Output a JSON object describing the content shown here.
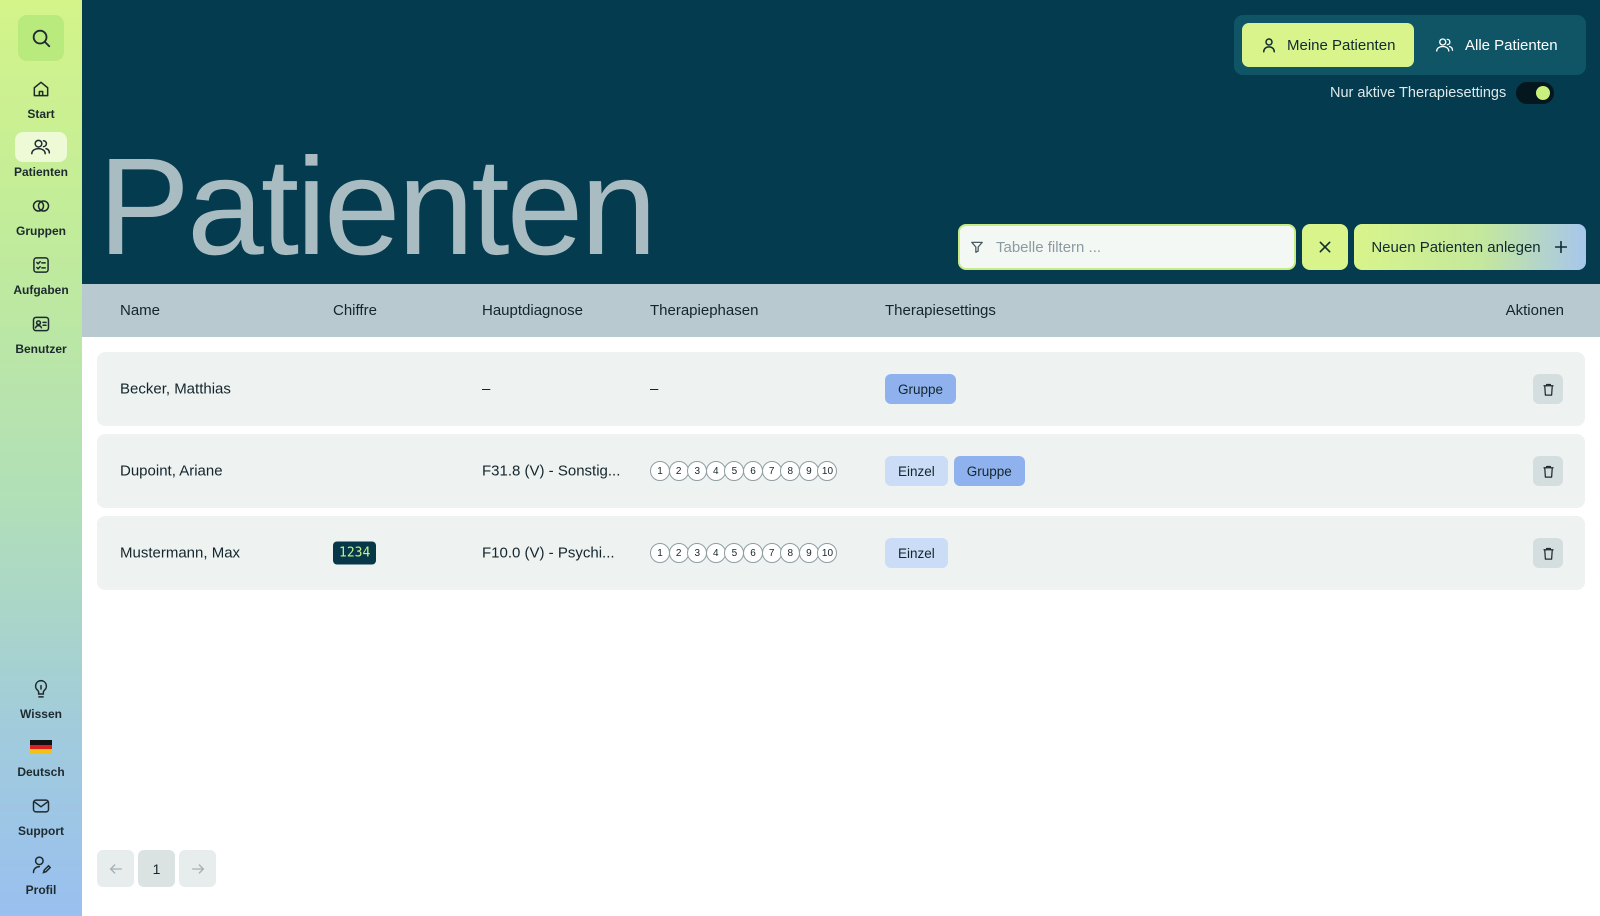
{
  "sidebar": {
    "top_items": [
      {
        "label": "Start",
        "icon": "home-icon"
      },
      {
        "label": "Patienten",
        "icon": "users-icon",
        "active": true
      },
      {
        "label": "Gruppen",
        "icon": "groups-icon"
      },
      {
        "label": "Aufgaben",
        "icon": "tasks-icon"
      },
      {
        "label": "Benutzer",
        "icon": "user-card-icon"
      }
    ],
    "bottom_items": [
      {
        "label": "Wissen",
        "icon": "lightbulb-icon"
      },
      {
        "label": "Deutsch",
        "icon": "german-flag-icon"
      },
      {
        "label": "Support",
        "icon": "mail-icon"
      },
      {
        "label": "Profil",
        "icon": "profile-icon"
      }
    ]
  },
  "header": {
    "title": "Patienten",
    "scope": {
      "mine": "Meine Patienten",
      "all": "Alle Patienten",
      "selected": "mine"
    },
    "active_toggle": {
      "label": "Nur aktive Therapiesettings",
      "on": true
    },
    "filter": {
      "placeholder": "Tabelle filtern ...",
      "value": ""
    },
    "add_button": "Neuen Patienten anlegen"
  },
  "table": {
    "columns": [
      "Name",
      "Chiffre",
      "Hauptdiagnose",
      "Therapiephasen",
      "Therapiesettings",
      "Aktionen"
    ],
    "rows": [
      {
        "name": "Becker, Matthias",
        "chiffre": "",
        "diagnose": "–",
        "phasen": "–",
        "settings": [
          "Gruppe"
        ]
      },
      {
        "name": "Dupoint, Ariane",
        "chiffre": "",
        "diagnose": "F31.8 (V) - Sonstig...",
        "phasen": [
          "1",
          "2",
          "3",
          "4",
          "5",
          "6",
          "7",
          "8",
          "9",
          "10"
        ],
        "settings": [
          "Einzel",
          "Gruppe"
        ]
      },
      {
        "name": "Mustermann, Max",
        "chiffre": "1234",
        "diagnose": "F10.0 (V) - Psychi...",
        "phasen": [
          "1",
          "2",
          "3",
          "4",
          "5",
          "6",
          "7",
          "8",
          "9",
          "10"
        ],
        "settings": [
          "Einzel"
        ]
      }
    ]
  },
  "pagination": {
    "current": "1"
  },
  "colors": {
    "header_bg": "#043b4f",
    "accent_lime": "#d8f48b",
    "einzel_tag": "#cbdcf6",
    "gruppe_tag": "#8fb2ee"
  }
}
